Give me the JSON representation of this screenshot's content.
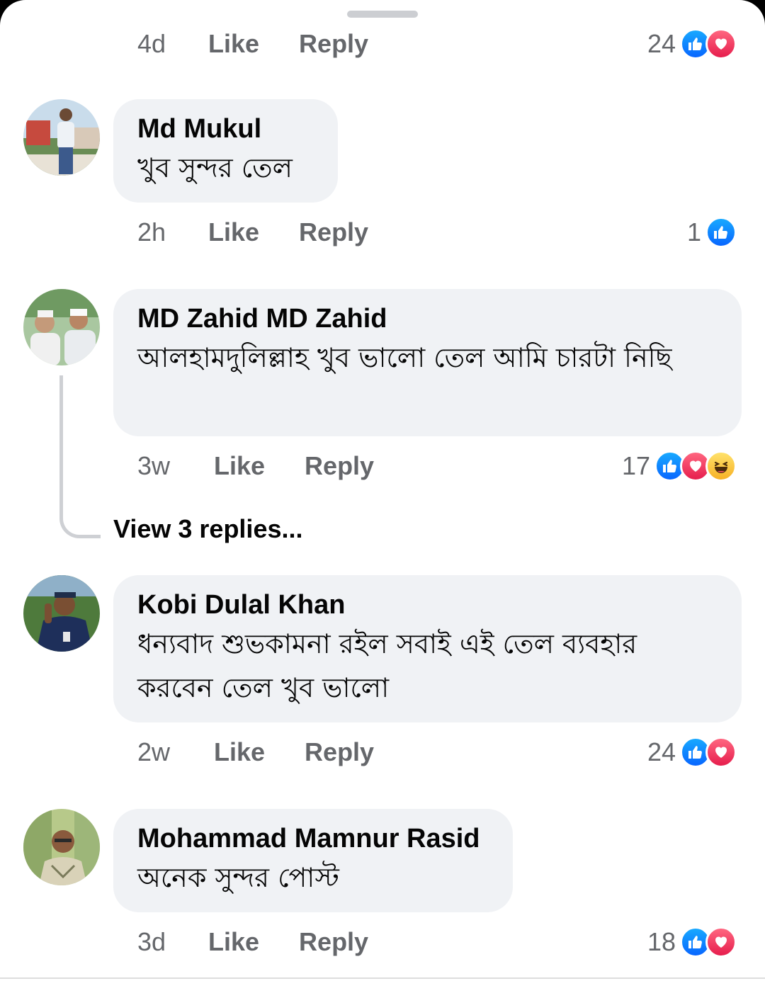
{
  "top_actions": {
    "time": "4d",
    "like": "Like",
    "reply": "Reply",
    "count": "24"
  },
  "comments": [
    {
      "author": "Md Mukul",
      "text": "খুব সুন্দর তেল",
      "time": "2h",
      "like": "Like",
      "reply": "Reply",
      "count": "1",
      "reactions": [
        "like"
      ]
    },
    {
      "author": "MD Zahid MD Zahid",
      "text": "আলহামদুলিল্লাহ খুব ভালো তেল আমি চারটা নিছি",
      "time": "3w",
      "like": "Like",
      "reply": "Reply",
      "count": "17",
      "reactions": [
        "like",
        "love",
        "haha"
      ],
      "view_replies": "View 3 replies..."
    },
    {
      "author": "Kobi Dulal Khan",
      "text": "ধন্যবাদ শুভকামনা রইল সবাই এই তেল ব্যবহার করবেন তেল খুব ভালো",
      "time": "2w",
      "like": "Like",
      "reply": "Reply",
      "count": "24",
      "reactions": [
        "like",
        "love"
      ]
    },
    {
      "author": "Mohammad Mamnur Rasid",
      "text": "অনেক সুন্দর পোস্ট",
      "time": "3d",
      "like": "Like",
      "reply": "Reply",
      "count": "18",
      "reactions": [
        "like",
        "love"
      ]
    }
  ],
  "colors": {
    "bubble": "#f0f2f5",
    "secondary_text": "#65676b",
    "like_blue": "#0866ff",
    "love_red": "#e61e4d",
    "haha_yellow": "#f7b125"
  }
}
